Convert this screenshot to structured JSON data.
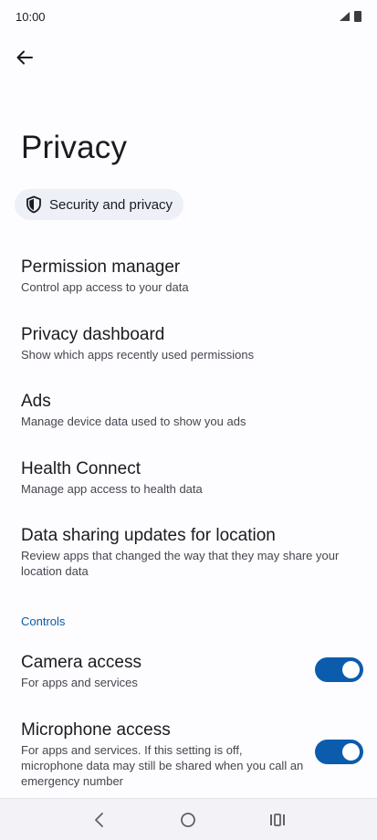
{
  "status_bar": {
    "time": "10:00",
    "icons": [
      "wifi-icon",
      "signal-icon"
    ]
  },
  "header": {
    "back_icon": "arrow-left-icon",
    "title": "Privacy"
  },
  "chip": {
    "icon": "shield-icon",
    "label": "Security and privacy"
  },
  "items": [
    {
      "title": "Permission manager",
      "summary": "Control app access to your data"
    },
    {
      "title": "Privacy dashboard",
      "summary": "Show which apps recently used permissions"
    },
    {
      "title": "Ads",
      "summary": "Manage device data used to show you ads"
    },
    {
      "title": "Health Connect",
      "summary": "Manage app access to health data"
    },
    {
      "title": "Data sharing updates for location",
      "summary": "Review apps that changed the way that they may share your location data"
    }
  ],
  "controls": {
    "header": "Controls",
    "toggles": [
      {
        "title": "Camera access",
        "summary": "For apps and services",
        "on": true
      },
      {
        "title": "Microphone access",
        "summary": "For apps and services. If this setting is off, microphone data may still be shared when you call an emergency number",
        "on": true
      }
    ]
  },
  "nav_bar": {
    "icons": [
      "back-nav-icon",
      "home-nav-icon",
      "recents-nav-icon"
    ]
  },
  "colors": {
    "accent": "#0b5cad",
    "section_header": "#0a5ca8",
    "chip_bg": "#eef0f8",
    "background": "#fdfcff"
  }
}
